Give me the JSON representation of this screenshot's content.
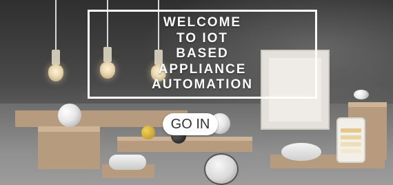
{
  "hero": {
    "welcome_lines": [
      "WELCOME",
      "TO IOT",
      "BASED",
      "APPLIANCE",
      "AUTOMATION"
    ]
  },
  "actions": {
    "enter_label": "GO IN"
  },
  "colors": {
    "overlay_border": "#ffffff",
    "button_bg": "#ffffff",
    "button_text": "#333333",
    "wood": "#b79b7e"
  }
}
